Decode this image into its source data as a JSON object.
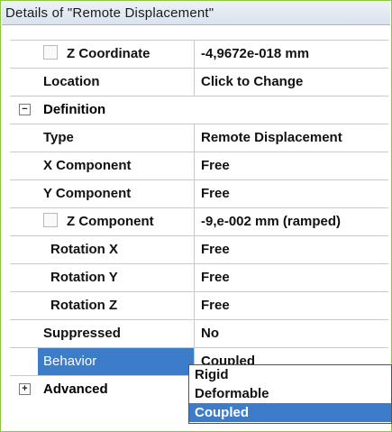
{
  "panel": {
    "title": "Details of \"Remote Displacement\""
  },
  "rows": {
    "z_coordinate": {
      "label": "Z Coordinate",
      "value": "-4,9672e-018 mm"
    },
    "location": {
      "label": "Location",
      "value": "Click to Change"
    }
  },
  "definition": {
    "label": "Definition",
    "expander": "−",
    "type": {
      "label": "Type",
      "value": "Remote Displacement"
    },
    "x_component": {
      "label": "X Component",
      "value": "Free"
    },
    "y_component": {
      "label": "Y Component",
      "value": "Free"
    },
    "z_component": {
      "label": "Z Component",
      "value": "-9,e-002 mm  (ramped)"
    },
    "rotation_x": {
      "label": "Rotation X",
      "value": "Free"
    },
    "rotation_y": {
      "label": "Rotation Y",
      "value": "Free"
    },
    "rotation_z": {
      "label": "Rotation Z",
      "value": "Free"
    },
    "suppressed": {
      "label": "Suppressed",
      "value": "No"
    },
    "behavior": {
      "label": "Behavior",
      "value": "Coupled"
    }
  },
  "advanced": {
    "label": "Advanced",
    "expander": "+"
  },
  "behavior_dropdown": {
    "options": [
      "Rigid",
      "Deformable",
      "Coupled"
    ],
    "selected": "Coupled"
  },
  "colors": {
    "frame_border": "#8dc63f",
    "selection": "#3d7cc9"
  }
}
